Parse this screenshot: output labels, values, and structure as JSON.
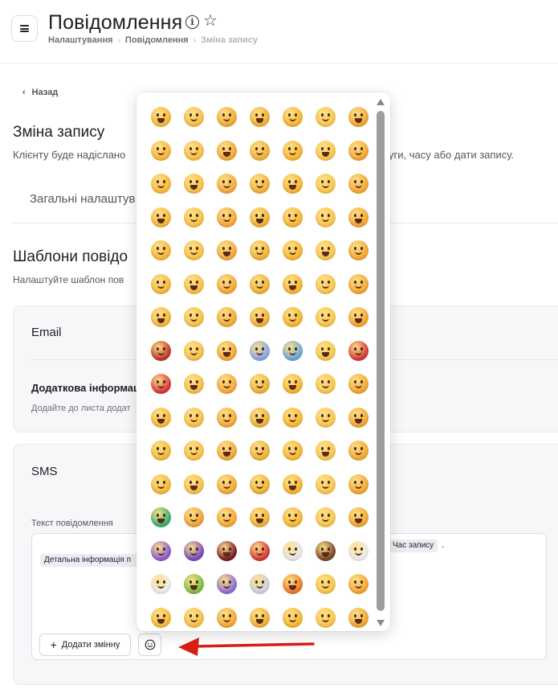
{
  "header": {
    "title": "Повідомлення",
    "breadcrumb": [
      "Налаштування",
      "Повідомлення",
      "Зміна запису"
    ]
  },
  "back_link": "Назад",
  "section": {
    "title": "Зміна запису",
    "description": "Клієнту буде надіслано",
    "description_tail": "уги, часу або дати запису."
  },
  "tabs": {
    "general": "Загальні налаштув"
  },
  "templates": {
    "title": "Шаблони повідо",
    "description": "Налаштуйте шаблон пов"
  },
  "email_card": {
    "title": "Email",
    "additional_title": "Додаткова інформаці",
    "additional_desc": "Додайте до листа додат"
  },
  "sms_card": {
    "title": "SMS",
    "field_label": "Текст повідомлення",
    "chip_detail": "Детальна інформація п",
    "chip_time": "Час запису",
    "dot_after": ".",
    "add_variable": "Додати змінну"
  },
  "emoji_picker": {
    "emojis": [
      "😀",
      "😃",
      "😄",
      "😁",
      "😆",
      "😅",
      "😂",
      "🤣",
      "😊",
      "😇",
      "🙂",
      "🙃",
      "😉",
      "😌",
      "😍",
      "🥰",
      "😘",
      "😗",
      "😙",
      "😚",
      "😋",
      "😛",
      "😝",
      "😜",
      "🤪",
      "🤨",
      "🧐",
      "🤓",
      "😎",
      "🤩",
      "🥳",
      "😏",
      "😒",
      "😞",
      "😔",
      "😟",
      "😕",
      "🙁",
      "☹️",
      "😣",
      "😖",
      "😫",
      "😩",
      "🥺",
      "😢",
      "😭",
      "😤",
      "😠",
      "😡",
      "🤬",
      "🤯",
      "😳",
      "🥵",
      "🥶",
      "😱",
      "😨",
      "😰",
      "😥",
      "😓",
      "🤗",
      "🤔",
      "🤭",
      "🤫",
      "🤥",
      "😶",
      "😶‍🌫️",
      "😐",
      "😑",
      "😬",
      "🙄",
      "😯",
      "😦",
      "😧",
      "😮",
      "😲",
      "🥱",
      "😴",
      "🤤",
      "😪",
      "😵",
      "😵‍💫",
      "🤐",
      "🥴",
      "🤢",
      "🤮",
      "🤧",
      "😷",
      "🤒",
      "🤕",
      "🤑",
      "🤠",
      "😈",
      "👿",
      "👹",
      "👺",
      "🤡",
      "💩",
      "👻",
      "💀",
      "👽",
      "👾",
      "🤖",
      "🎃",
      "😺",
      "😸",
      "😹",
      "😻",
      "😼",
      "😽",
      "🙀",
      "😿",
      "😾"
    ]
  }
}
